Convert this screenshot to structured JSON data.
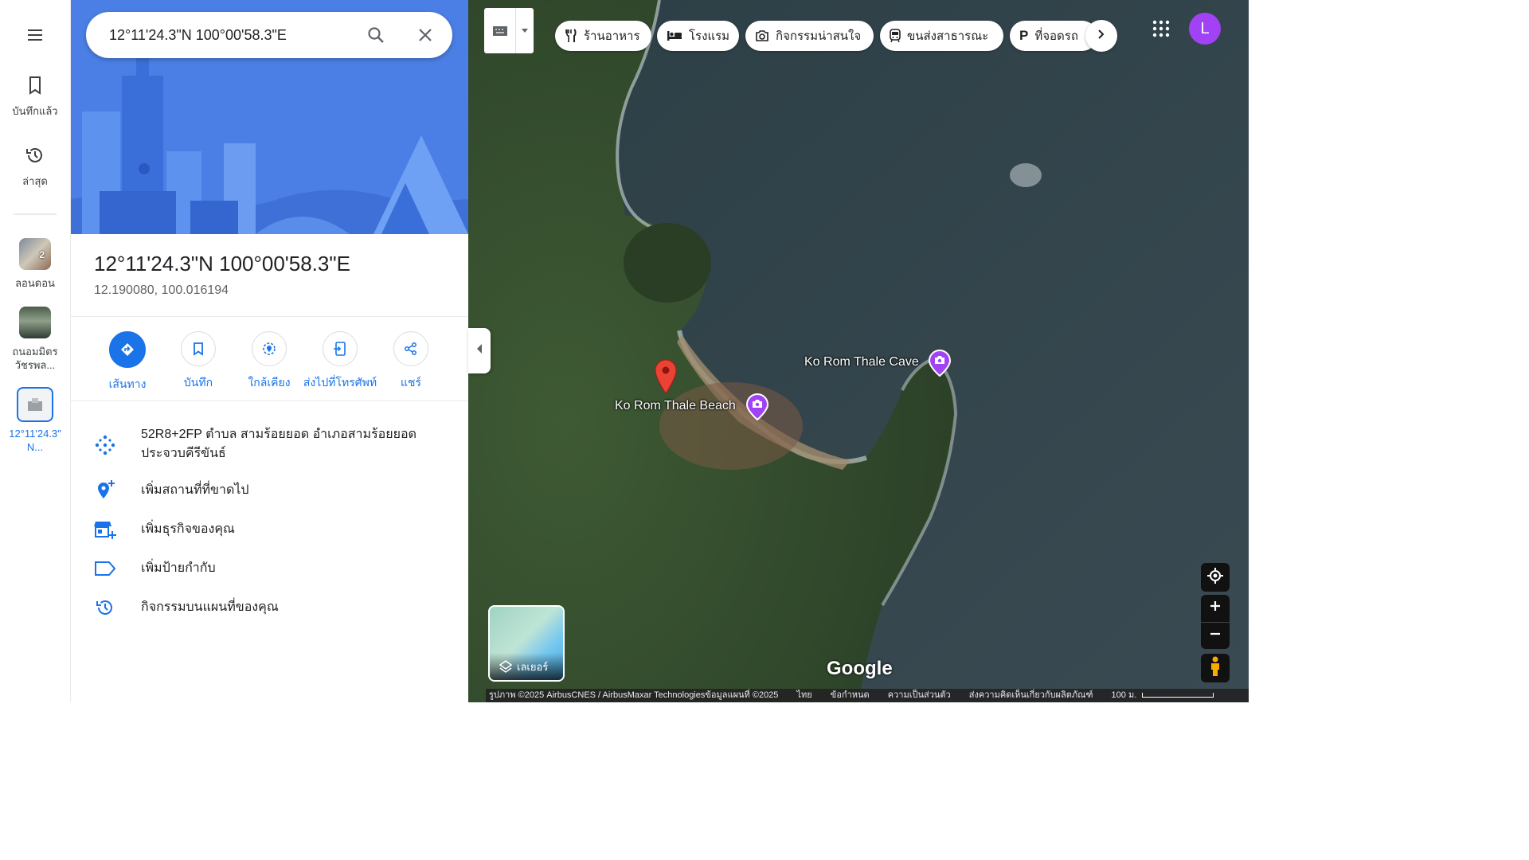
{
  "rail": {
    "menu_icon": "menu-icon",
    "saved_label": "บันทึกแล้ว",
    "recent_label": "ล่าสุด",
    "recents": [
      {
        "label": "ลอนดอน",
        "badge": "2"
      },
      {
        "label": "ถนอมมิตร วัชรพล..."
      },
      {
        "label": "12°11'24.3\" N..."
      }
    ]
  },
  "search": {
    "value": "12°11'24.3\"N 100°00'58.3\"E",
    "search_icon": "search-icon",
    "close_icon": "close-icon"
  },
  "place": {
    "title": "12°11'24.3\"N 100°00'58.3\"E",
    "coords": "12.190080, 100.016194"
  },
  "actions": [
    {
      "label": "เส้นทาง",
      "icon": "directions-icon"
    },
    {
      "label": "บันทึก",
      "icon": "bookmark-icon"
    },
    {
      "label": "ใกล้เคียง",
      "icon": "nearby-icon"
    },
    {
      "label": "ส่งไปที่โทรศัพท์",
      "icon": "send-to-phone-icon"
    },
    {
      "label": "แชร์",
      "icon": "share-icon"
    }
  ],
  "info": {
    "plus_code": "52R8+2FP ตำบล สามร้อยยอด อำเภอสามร้อยยอด ประจวบคีรีขันธ์",
    "add_place": "เพิ่มสถานที่ที่ขาดไป",
    "add_business": "เพิ่มธุรกิจของคุณ",
    "add_label": "เพิ่มป้ายกำกับ",
    "activity": "กิจกรรมบนแผนที่ของคุณ"
  },
  "chips": [
    {
      "label": "ร้านอาหาร",
      "icon": "restaurant-icon"
    },
    {
      "label": "โรงแรม",
      "icon": "hotel-icon"
    },
    {
      "label": "กิจกรรมน่าสนใจ",
      "icon": "camera-icon"
    },
    {
      "label": "ขนส่งสาธารณะ",
      "icon": "transit-icon"
    },
    {
      "label": "ที่จอดรถ",
      "icon": "parking-icon"
    }
  ],
  "account": {
    "initial": "L",
    "color": "#a142f4"
  },
  "map": {
    "poi_beach": "Ko Rom Thale Beach",
    "poi_cave": "Ko Rom Thale Cave",
    "layers_label": "เลเยอร์",
    "google_logo": "Google",
    "pin_color": "#ea4335",
    "poi_color": "#a142f4"
  },
  "footer": {
    "imagery": "รูปภาพ ©2025 AirbusCNES / AirbusMaxar Technologiesข้อมูลแผนที่ ©2025",
    "language": "ไทย",
    "terms": "ข้อกำหนด",
    "privacy": "ความเป็นส่วนตัว",
    "feedback": "ส่งความคิดเห็นเกี่ยวกับผลิตภัณฑ์",
    "scale": "100 ม."
  },
  "colors": {
    "accent": "#1a73e8",
    "hero": "#4a7fe6"
  }
}
